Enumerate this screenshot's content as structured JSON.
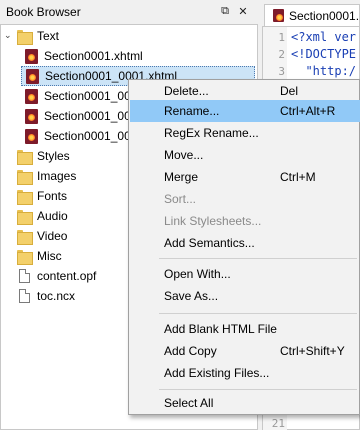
{
  "dock": {
    "title": "Book Browser",
    "float_glyph": "⧉",
    "close_glyph": "✕"
  },
  "tree": {
    "text_folder": "Text",
    "text_files": [
      "Section0001.xhtml",
      "Section0001_0001.xhtml",
      "Section0001_000",
      "Section0001_000",
      "Section0001_000"
    ],
    "folders": [
      "Styles",
      "Images",
      "Fonts",
      "Audio",
      "Video",
      "Misc"
    ],
    "files": [
      "content.opf",
      "toc.ncx"
    ],
    "expander_glyph": "⌄"
  },
  "editor": {
    "tab_label": "Section0001.",
    "line_numbers": [
      "1",
      "2",
      "3",
      "4",
      "5",
      "6",
      "7",
      "8",
      "9",
      "10",
      "11",
      "12",
      "13",
      "14",
      "15",
      "16",
      "17",
      "18",
      "19",
      "20",
      "21"
    ],
    "code_lines": [
      "<?xml ver",
      "<!DOCTYPE",
      "  \"http:/"
    ]
  },
  "context_menu": {
    "items": [
      {
        "label": "Delete...",
        "shortcut": "Del",
        "enabled": true
      },
      {
        "label": "Rename...",
        "shortcut": "Ctrl+Alt+R",
        "enabled": true,
        "highlighted": true
      },
      {
        "label": "RegEx Rename...",
        "shortcut": "",
        "enabled": true
      },
      {
        "label": "Move...",
        "shortcut": "",
        "enabled": true
      },
      {
        "label": "Merge",
        "shortcut": "Ctrl+M",
        "enabled": true
      },
      {
        "label": "Sort...",
        "shortcut": "",
        "enabled": false
      },
      {
        "label": "Link Stylesheets...",
        "shortcut": "",
        "enabled": false
      },
      {
        "label": "Add Semantics...",
        "shortcut": "",
        "enabled": true
      },
      {
        "label": "Open With...",
        "shortcut": "",
        "enabled": true
      },
      {
        "label": "Save As...",
        "shortcut": "",
        "enabled": true
      },
      {
        "label": "Add Blank HTML File",
        "shortcut": "",
        "enabled": true
      },
      {
        "label": "Add Copy",
        "shortcut": "Ctrl+Shift+Y",
        "enabled": true
      },
      {
        "label": "Add Existing Files...",
        "shortcut": "",
        "enabled": true
      },
      {
        "label": "Select All",
        "shortcut": "",
        "enabled": true
      }
    ]
  },
  "colors": {
    "menu_highlight": "#91c9f7",
    "selection": "#cce4f7",
    "code": "#1a3fb4"
  }
}
